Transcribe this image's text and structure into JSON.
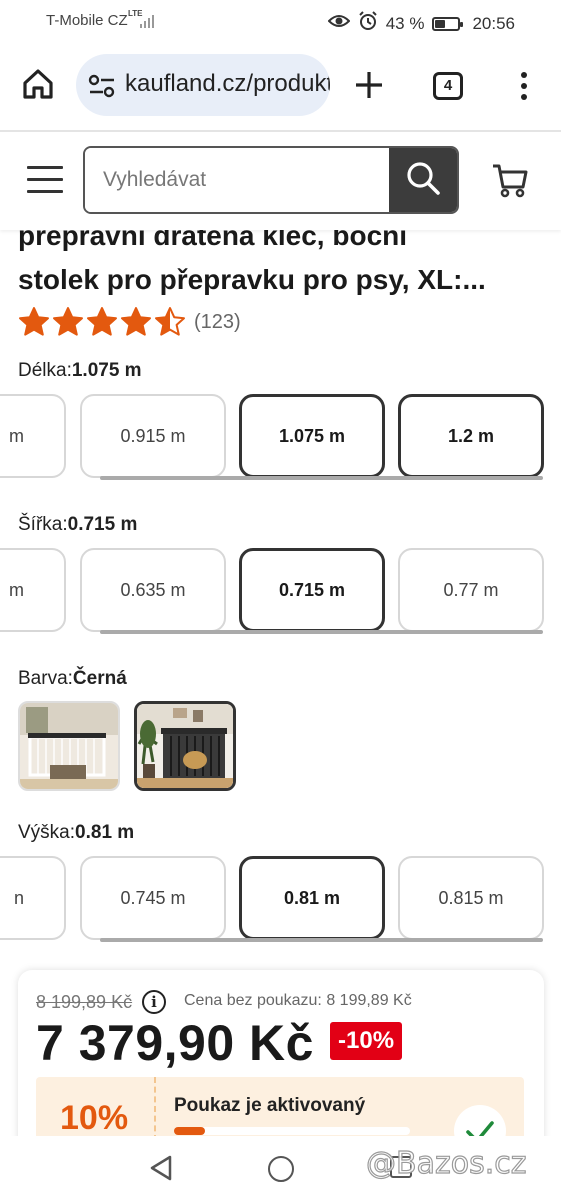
{
  "status_bar": {
    "carrier": "T-Mobile CZ",
    "network": "LTE",
    "battery_percent": "43 %",
    "battery_level": 0.43,
    "time": "20:56",
    "icons": [
      "eye-icon",
      "alarm-icon",
      "battery-icon"
    ]
  },
  "browser": {
    "url": "kaufland.cz/produkt",
    "tab_count": "4",
    "icons": [
      "home-icon",
      "site-settings-icon",
      "plus-icon",
      "tabs-icon",
      "more-vert-icon"
    ]
  },
  "site_header": {
    "search_placeholder": "Vyhledávat",
    "icons": [
      "menu-icon",
      "search-icon",
      "cart-icon"
    ]
  },
  "product": {
    "title_lines": [
      "přepravní drátěná klec, boční",
      "stolek pro přepravku pro psy, XL:..."
    ],
    "rating_value": 4.5,
    "rating_count": "(123)",
    "star_color": "#e3590f"
  },
  "variants": {
    "length": {
      "label": "Délka:",
      "value": "1.075 m",
      "options": [
        {
          "label": "m",
          "selected": false
        },
        {
          "label": "0.915 m",
          "selected": false
        },
        {
          "label": "1.075 m",
          "selected": true
        },
        {
          "label": "1.2 m",
          "selected": true
        }
      ]
    },
    "width": {
      "label": "Šířka:",
      "value": "0.715 m",
      "options": [
        {
          "label": "m",
          "selected": false
        },
        {
          "label": "0.635 m",
          "selected": false
        },
        {
          "label": "0.715 m",
          "selected": true
        },
        {
          "label": "0.77 m",
          "selected": false
        }
      ]
    },
    "color": {
      "label": "Barva:",
      "value": "Černá",
      "swatches": [
        {
          "name": "white-variant",
          "selected": false
        },
        {
          "name": "black-variant",
          "selected": true
        }
      ]
    },
    "height": {
      "label": "Výška:",
      "value": "0.81 m",
      "options": [
        {
          "label": "n",
          "selected": false
        },
        {
          "label": "0.745 m",
          "selected": false
        },
        {
          "label": "0.81 m",
          "selected": true
        },
        {
          "label": "0.815 m",
          "selected": false
        }
      ]
    }
  },
  "price": {
    "old_price": "8 199,89 Kč",
    "no_coupon_text": "Cena bez poukazu: 8 199,89 Kč",
    "current_price": "7 379,90 Kč",
    "discount_badge": "-10%",
    "badge_color": "#e20015",
    "coupon": {
      "percent": "10%",
      "title": "Poukaz je aktivovaný",
      "progress": 0.13,
      "accent": "#e3590f"
    }
  },
  "nav_bar": {
    "icons": [
      "back-icon",
      "home-circle-icon",
      "recents-icon"
    ],
    "watermark": "@Bazos.cz"
  }
}
